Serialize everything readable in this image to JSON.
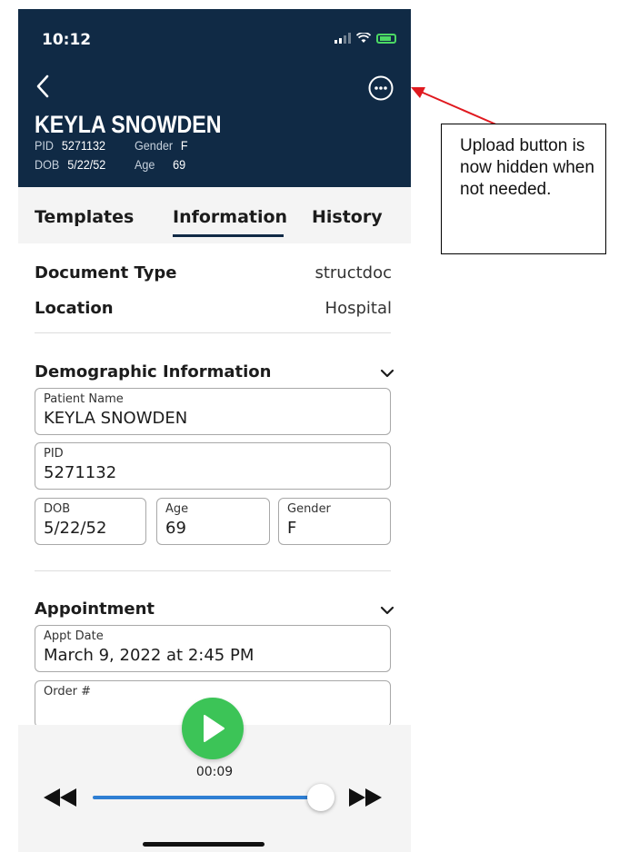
{
  "status_bar": {
    "time": "10:12"
  },
  "header": {
    "name": "KEYLA SNOWDEN",
    "pid_label": "PID",
    "pid_value": "5271132",
    "gender_label": "Gender",
    "gender_value": "F",
    "dob_label": "DOB",
    "dob_value": "5/22/52",
    "age_label": "Age",
    "age_value": "69"
  },
  "tabs": [
    {
      "label": "Templates",
      "active": false
    },
    {
      "label": "Information",
      "active": true
    },
    {
      "label": "History",
      "active": false
    }
  ],
  "info": {
    "document_type_label": "Document Type",
    "document_type_value": "structdoc",
    "location_label": "Location",
    "location_value": "Hospital"
  },
  "demographics": {
    "title": "Demographic Information",
    "patient_name_label": "Patient Name",
    "patient_name_value": "KEYLA SNOWDEN",
    "pid_label": "PID",
    "pid_value": "5271132",
    "dob_label": "DOB",
    "dob_value": "5/22/52",
    "age_label": "Age",
    "age_value": "69",
    "gender_label": "Gender",
    "gender_value": "F"
  },
  "appointment": {
    "title": "Appointment",
    "appt_date_label": "Appt Date",
    "appt_date_value": "March 9, 2022 at 2:45 PM",
    "order_label": "Order #",
    "order_value": ""
  },
  "player": {
    "elapsed": "00:09",
    "progress": 0.95
  },
  "annotation": {
    "text": "Upload button is now hidden when not needed.",
    "arrow_color": "#e0191f"
  },
  "colors": {
    "header_bg": "#102a45",
    "play_green": "#3cc457",
    "track_blue": "#2f7fd3"
  }
}
